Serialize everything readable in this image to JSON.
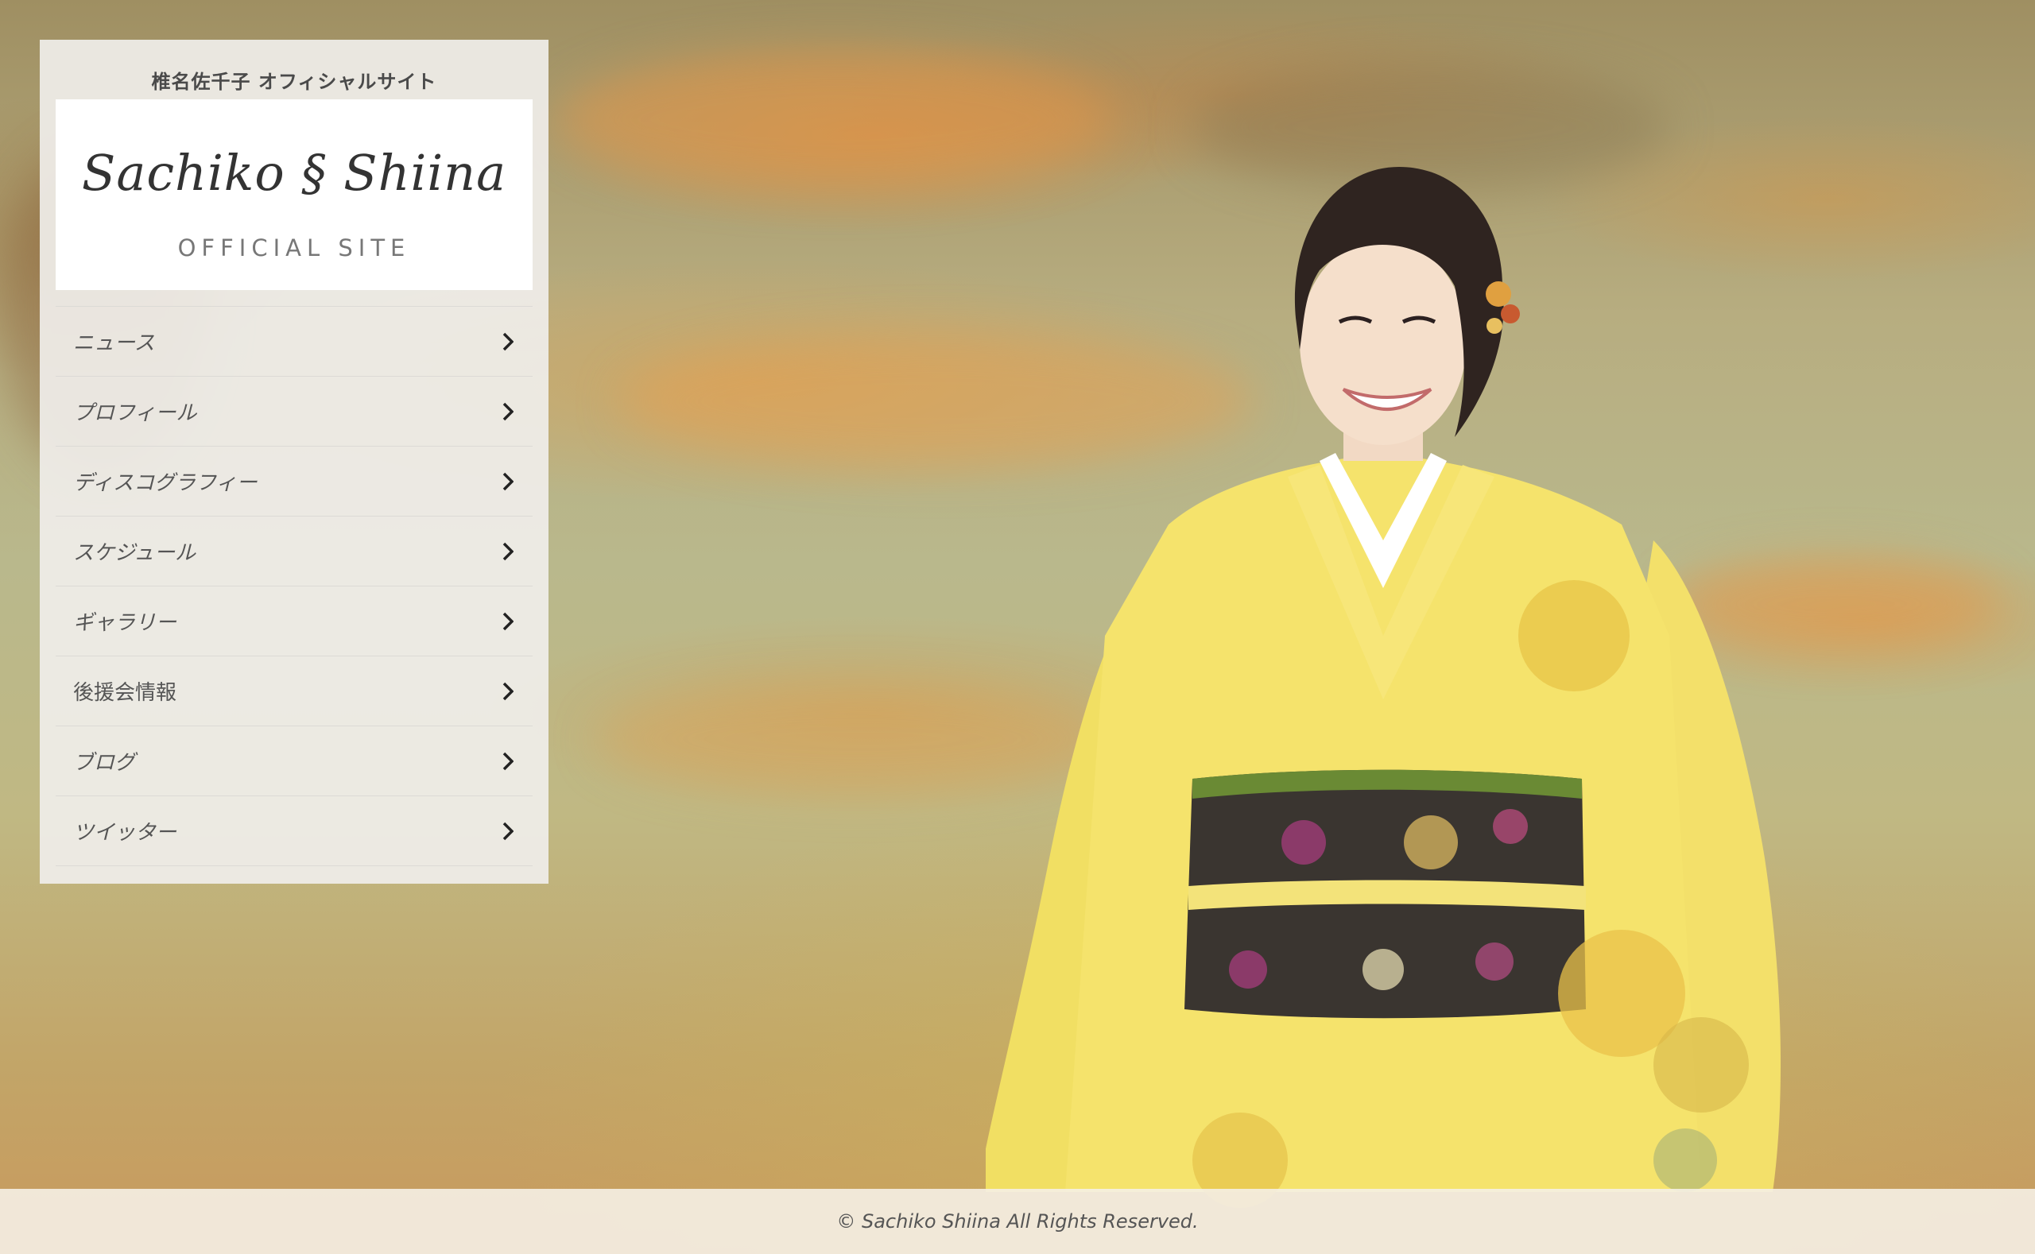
{
  "header": {
    "site_title": "椎名佐千子 オフィシャルサイト"
  },
  "logo": {
    "script_text": "Sachiko § Shiina",
    "subtitle": "OFFICIAL SITE"
  },
  "nav": {
    "items": [
      {
        "label": "ニュース",
        "icon": "chevron-right-icon"
      },
      {
        "label": "プロフィール",
        "icon": "chevron-right-icon"
      },
      {
        "label": "ディスコグラフィー",
        "icon": "chevron-right-icon"
      },
      {
        "label": "スケジュール",
        "icon": "chevron-right-icon"
      },
      {
        "label": "ギャラリー",
        "icon": "chevron-right-icon"
      },
      {
        "label": "後援会情報",
        "icon": "chevron-right-icon"
      },
      {
        "label": "ブログ",
        "icon": "chevron-right-icon"
      },
      {
        "label": "ツイッター",
        "icon": "chevron-right-icon"
      }
    ]
  },
  "footer": {
    "copyright": "© Sachiko Shiina All Rights Reserved."
  },
  "colors": {
    "panel_bg": "#f0eeea",
    "text": "#555555",
    "kimono": "#f3e06a",
    "obi": "#3a3530"
  }
}
